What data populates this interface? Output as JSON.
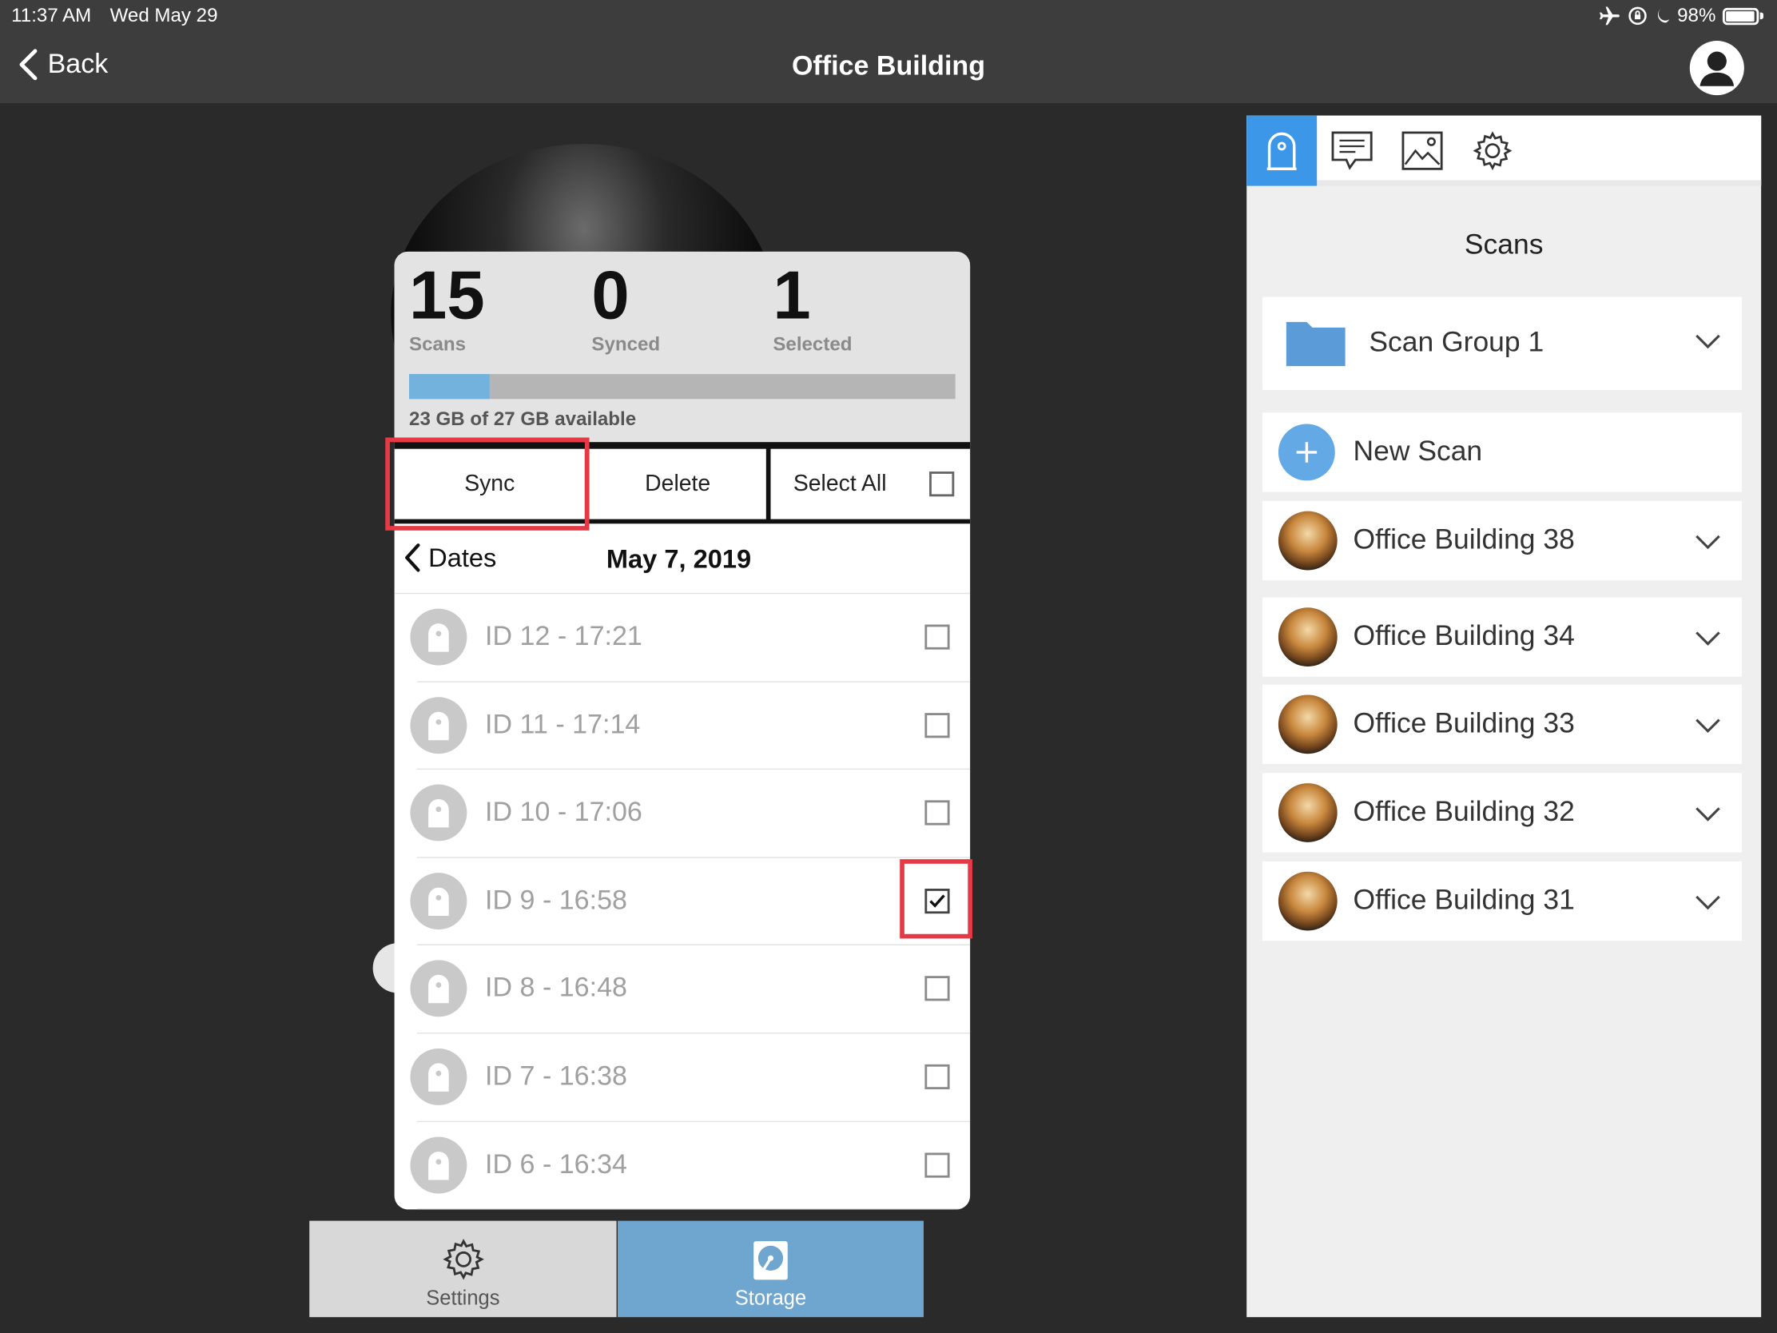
{
  "status_bar": {
    "time": "11:37 AM",
    "date": "Wed May 29",
    "battery": "98%",
    "icons": [
      "airplane-icon",
      "orientation-lock-icon",
      "moon-icon",
      "battery-icon"
    ]
  },
  "nav": {
    "back_label": "Back",
    "title": "Office Building"
  },
  "stats": {
    "scans_count": "15",
    "scans_label": "Scans",
    "synced_count": "0",
    "synced_label": "Synced",
    "selected_count": "1",
    "selected_label": "Selected",
    "storage_text": "23 GB of 27 GB available",
    "storage_fill_fraction": 0.148
  },
  "actions": {
    "sync_label": "Sync",
    "delete_label": "Delete",
    "select_all_label": "Select All"
  },
  "dates": {
    "back_label": "Dates",
    "current_date": "May 7, 2019"
  },
  "scans": [
    {
      "label": "ID 12 - 17:21",
      "checked": false
    },
    {
      "label": "ID 11 - 17:14",
      "checked": false
    },
    {
      "label": "ID 10 - 17:06",
      "checked": false
    },
    {
      "label": "ID 9 - 16:58",
      "checked": true
    },
    {
      "label": "ID 8 - 16:48",
      "checked": false
    },
    {
      "label": "ID 7 - 16:38",
      "checked": false
    },
    {
      "label": "ID 6 - 16:34",
      "checked": false
    }
  ],
  "bottom_tabs": {
    "settings_label": "Settings",
    "storage_label": "Storage"
  },
  "side_panel": {
    "tabs": [
      "scanner-icon",
      "comment-icon",
      "image-icon",
      "gear-icon"
    ],
    "title": "Scans",
    "group_label": "Scan Group 1",
    "new_scan_label": "New Scan",
    "items": [
      {
        "label": "Office Building  38"
      },
      {
        "label": "Office Building  34"
      },
      {
        "label": "Office Building  33"
      },
      {
        "label": "Office Building  32"
      },
      {
        "label": "Office Building  31"
      }
    ],
    "accent_color": "#3d97e8",
    "folder_color": "#5a9bd8"
  }
}
